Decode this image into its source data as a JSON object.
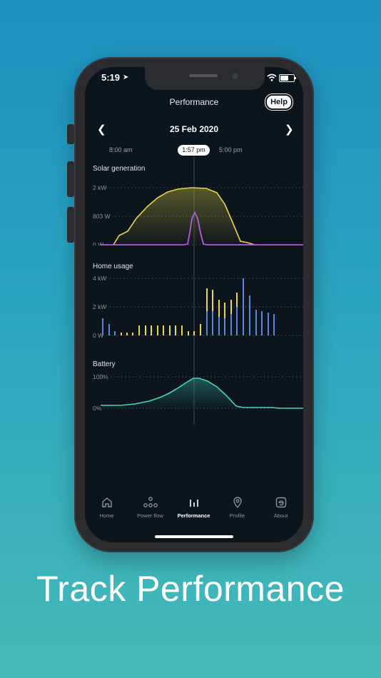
{
  "status_bar": {
    "time": "5:19"
  },
  "header": {
    "title": "Performance",
    "help_label": "Help"
  },
  "date_nav": {
    "date": "25 Feb 2020",
    "prev_icon": "chevron-left-icon",
    "next_icon": "chevron-right-icon"
  },
  "time_axis": {
    "start": "8:00 am",
    "current": "1:57 pm",
    "end": "5:00 pm"
  },
  "sections": {
    "solar": {
      "label": "Solar generation",
      "ticks": [
        "2 kW",
        "803 W",
        "0 W"
      ]
    },
    "home": {
      "label": "Home usage",
      "ticks": [
        "4 kW",
        "2 kW",
        "0 W"
      ]
    },
    "battery": {
      "label": "Battery",
      "ticks": [
        "100%",
        "0%"
      ]
    }
  },
  "colors": {
    "solar": "#e8d54a",
    "secondary": "#b15ce0",
    "grid_bar": "#5b84e6",
    "battery": "#45d3c2",
    "background": "#0c151b"
  },
  "tabs": [
    {
      "label": "Home",
      "icon": "home-icon",
      "active": false
    },
    {
      "label": "Power flow",
      "icon": "power-flow-icon",
      "active": false
    },
    {
      "label": "Performance",
      "icon": "bar-chart-icon",
      "active": true
    },
    {
      "label": "Profile",
      "icon": "location-pin-icon",
      "active": false
    },
    {
      "label": "About",
      "icon": "info-e-icon",
      "active": false
    }
  ],
  "caption": "Track Performance"
}
